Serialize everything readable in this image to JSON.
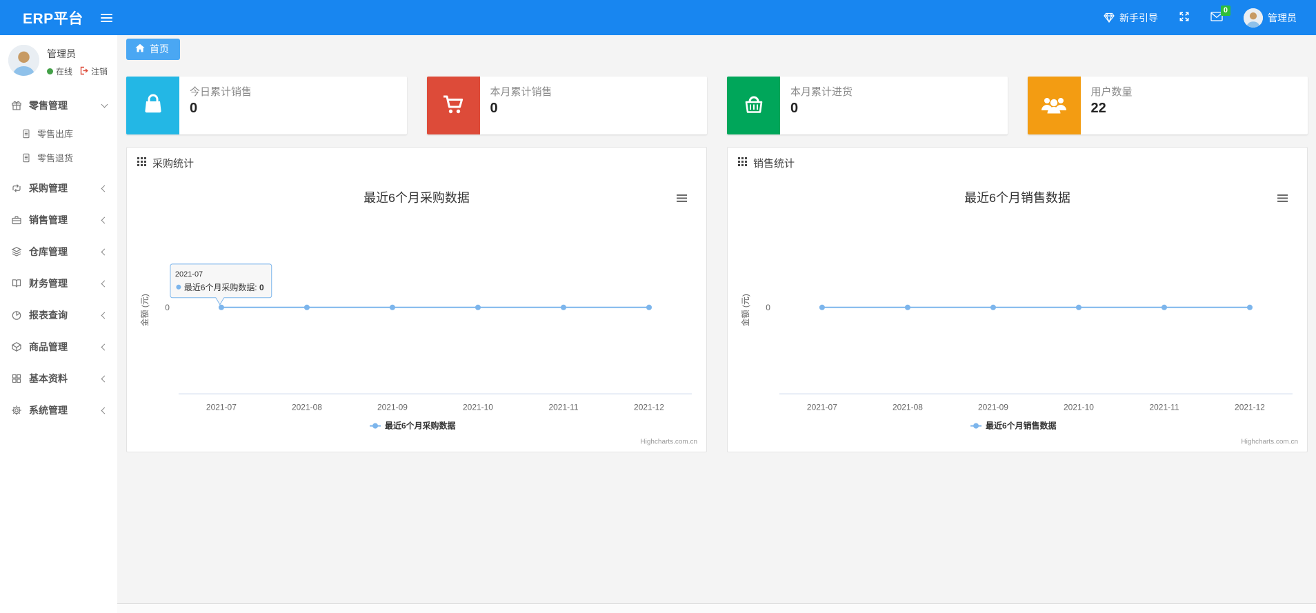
{
  "theme": {
    "navbar_color": "#1886f0",
    "tab_color": "#4aa7f3",
    "badge_color": "#2fbe3a",
    "online_color": "#43a047",
    "logout_color": "#dd4b39",
    "series_color": "#7cb5ec"
  },
  "navbar": {
    "brand": "ERP平台",
    "guide_label": "新手引导",
    "message_count": "0",
    "user_name": "管理员"
  },
  "sidebar": {
    "user": {
      "name": "管理员",
      "status": "在线",
      "logout_label": "注销"
    },
    "items": [
      {
        "label": "零售管理",
        "icon": "gift-icon",
        "expanded": true,
        "children": [
          {
            "label": "零售出库",
            "icon": "document-icon"
          },
          {
            "label": "零售退货",
            "icon": "document-icon"
          }
        ]
      },
      {
        "label": "采购管理",
        "icon": "loop-arrows-icon"
      },
      {
        "label": "销售管理",
        "icon": "briefcase-icon"
      },
      {
        "label": "仓库管理",
        "icon": "layers-icon"
      },
      {
        "label": "财务管理",
        "icon": "open-book-icon"
      },
      {
        "label": "报表查询",
        "icon": "pie-chart-icon"
      },
      {
        "label": "商品管理",
        "icon": "cube-icon"
      },
      {
        "label": "基本资料",
        "icon": "grid-icon"
      },
      {
        "label": "系统管理",
        "icon": "gear-icon"
      }
    ]
  },
  "breadcrumb": {
    "home_label": "首页"
  },
  "stat_cards": [
    {
      "title": "今日累计销售",
      "value": "0",
      "color": "#23b7e5",
      "icon": "shopping-bag-icon"
    },
    {
      "title": "本月累计销售",
      "value": "0",
      "color": "#dd4b39",
      "icon": "shopping-cart-icon"
    },
    {
      "title": "本月累计进货",
      "value": "0",
      "color": "#00a65a",
      "icon": "shopping-basket-icon"
    },
    {
      "title": "用户数量",
      "value": "22",
      "color": "#f39c12",
      "icon": "users-icon"
    }
  ],
  "panels": [
    {
      "title": "采购统计"
    },
    {
      "title": "销售统计"
    }
  ],
  "chart_data": [
    {
      "type": "line",
      "title": "最近6个月采购数据",
      "x": [
        "2021-07",
        "2021-08",
        "2021-09",
        "2021-10",
        "2021-11",
        "2021-12"
      ],
      "series": [
        {
          "name": "最近6个月采购数据",
          "values": [
            0,
            0,
            0,
            0,
            0,
            0
          ],
          "color": "#7cb5ec"
        }
      ],
      "xlabel": "",
      "ylabel": "金额 (元)",
      "yticks": [
        0
      ],
      "grid": false,
      "legend_position": "bottom",
      "credit": "Highcharts.com.cn",
      "tooltip": {
        "visible": true,
        "header": "2021-07",
        "series_name": "最近6个月采购数据",
        "value": "0"
      }
    },
    {
      "type": "line",
      "title": "最近6个月销售数据",
      "x": [
        "2021-07",
        "2021-08",
        "2021-09",
        "2021-10",
        "2021-11",
        "2021-12"
      ],
      "series": [
        {
          "name": "最近6个月销售数据",
          "values": [
            0,
            0,
            0,
            0,
            0,
            0
          ],
          "color": "#7cb5ec"
        }
      ],
      "xlabel": "",
      "ylabel": "金额 (元)",
      "yticks": [
        0
      ],
      "grid": false,
      "legend_position": "bottom",
      "credit": "Highcharts.com.cn",
      "tooltip": {
        "visible": false
      }
    }
  ]
}
